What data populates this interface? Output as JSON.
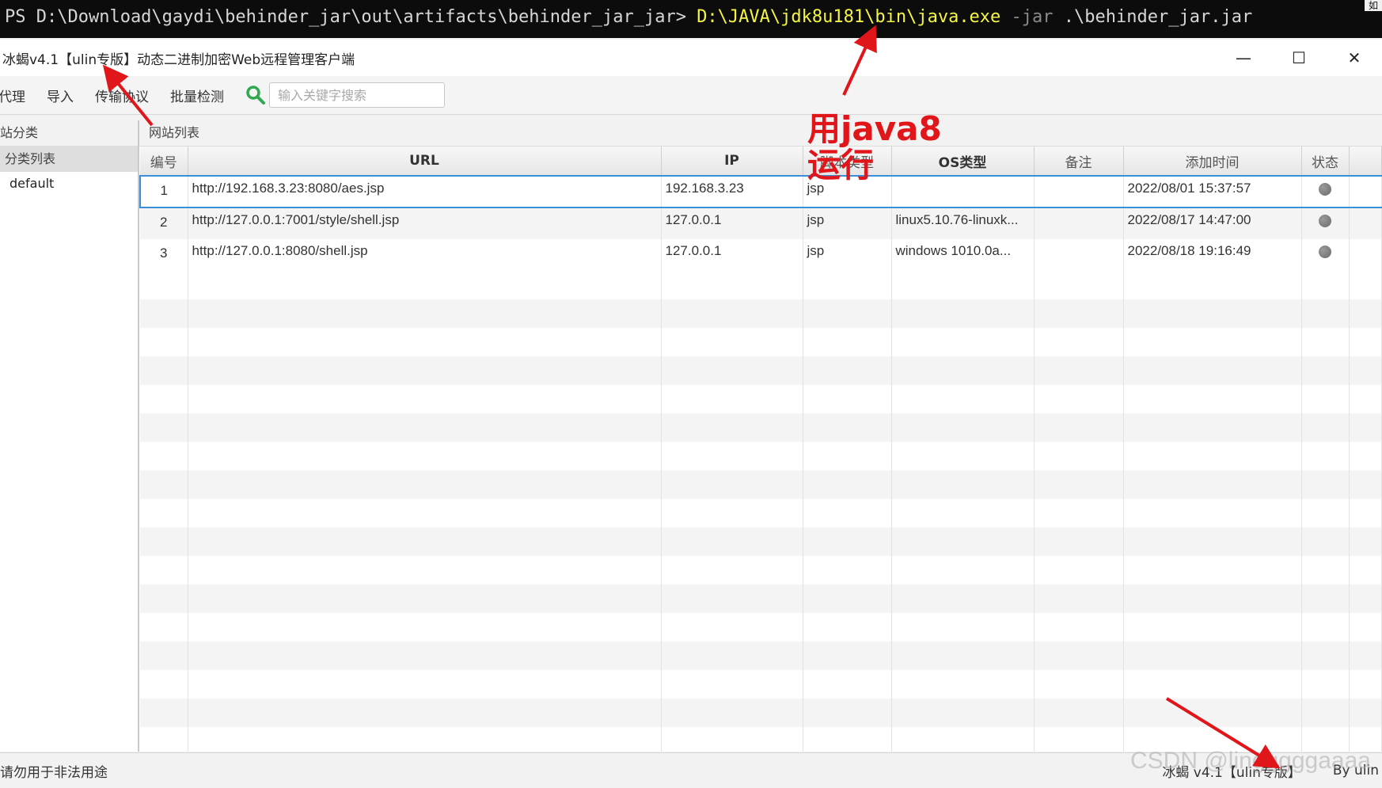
{
  "terminal": {
    "prompt": "PS D:\\Download\\gaydi\\behinder_jar\\out\\artifacts\\behinder_jar_jar>",
    "exe": "D:\\JAVA\\jdk8u181\\bin\\java.exe",
    "flag": "-jar",
    "arg": ".\\behinder_jar.jar",
    "edge_char": "如"
  },
  "window": {
    "title": "冰蝎v4.1【ulin专版】动态二进制加密Web远程管理客户端",
    "controls": {
      "minimize": "—",
      "maximize": "☐",
      "close": "✕"
    }
  },
  "toolbar": {
    "items": [
      "代理",
      "导入",
      "传输协议",
      "批量检测"
    ],
    "search_placeholder": "输入关键字搜索"
  },
  "left_panel": {
    "header": "站分类",
    "root": "分类列表",
    "items": [
      "default"
    ]
  },
  "right_panel": {
    "header": "网站列表",
    "columns": [
      "编号",
      "URL",
      "IP",
      "脚本类型",
      "OS类型",
      "备注",
      "添加时间",
      "状态"
    ],
    "rows": [
      {
        "id": "1",
        "url": "http://192.168.3.23:8080/aes.jsp",
        "ip": "192.168.3.23",
        "script": "jsp",
        "os": "",
        "note": "",
        "added": "2022/08/01 15:37:57"
      },
      {
        "id": "2",
        "url": "http://127.0.0.1:7001/style/shell.jsp",
        "ip": "127.0.0.1",
        "script": "jsp",
        "os": "linux5.10.76-linuxk...",
        "note": "",
        "added": "2022/08/17 14:47:00"
      },
      {
        "id": "3",
        "url": "http://127.0.0.1:8080/shell.jsp",
        "ip": "127.0.0.1",
        "script": "jsp",
        "os": "windows 1010.0a...",
        "note": "",
        "added": "2022/08/18 19:16:49"
      }
    ]
  },
  "statusbar": {
    "left": "请勿用于非法用途",
    "version": "冰蝎 v4.1【ulin专版】",
    "by": "By ulin"
  },
  "watermark": "CSDN @lingggggaaaa",
  "annotation": {
    "text": "用java8运行",
    "color": "#e0161b"
  }
}
